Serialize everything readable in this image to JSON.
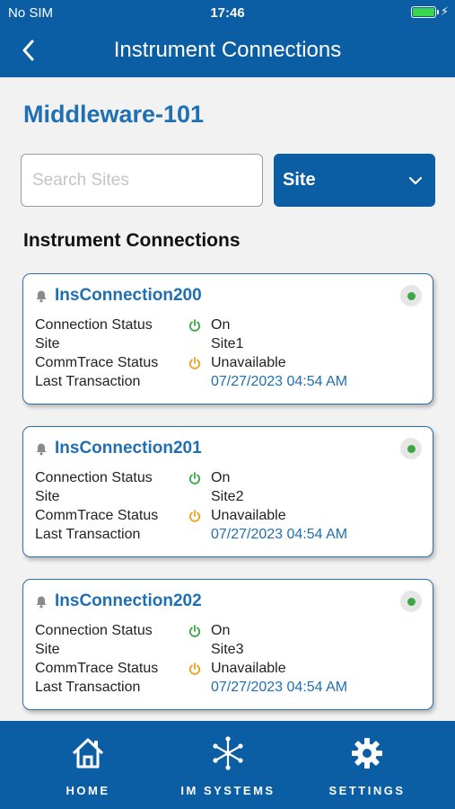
{
  "status_bar": {
    "carrier": "No SIM",
    "time": "17:46",
    "battery_level": 1.0
  },
  "nav": {
    "title": "Instrument Connections",
    "back_icon": "chevron-left-icon"
  },
  "page": {
    "title": "Middleware-101"
  },
  "search": {
    "placeholder": "Search Sites",
    "value": ""
  },
  "filter": {
    "selected": "Site",
    "icon": "chevron-down-icon"
  },
  "section_title": "Instrument Connections",
  "colors": {
    "primary": "#0b5ea3",
    "link": "#1f6fb2",
    "status_on": "#3aa843",
    "status_unavailable": "#f0a020"
  },
  "labels": {
    "connection_status": "Connection Status",
    "site": "Site",
    "commtrace_status": "CommTrace Status",
    "last_transaction": "Last Transaction"
  },
  "connections": [
    {
      "name": "InsConnection200",
      "connection_status": "On",
      "site": "Site1",
      "commtrace_status": "Unavailable",
      "last_transaction": "07/27/2023 04:54 AM"
    },
    {
      "name": "InsConnection201",
      "connection_status": "On",
      "site": "Site2",
      "commtrace_status": "Unavailable",
      "last_transaction": "07/27/2023 04:54 AM"
    },
    {
      "name": "InsConnection202",
      "connection_status": "On",
      "site": "Site3",
      "commtrace_status": "Unavailable",
      "last_transaction": "07/27/2023 04:54 AM"
    }
  ],
  "tabs": [
    {
      "label": "HOME",
      "icon": "home-icon"
    },
    {
      "label": "IM SYSTEMS",
      "icon": "network-icon"
    },
    {
      "label": "SETTINGS",
      "icon": "gear-icon"
    }
  ]
}
